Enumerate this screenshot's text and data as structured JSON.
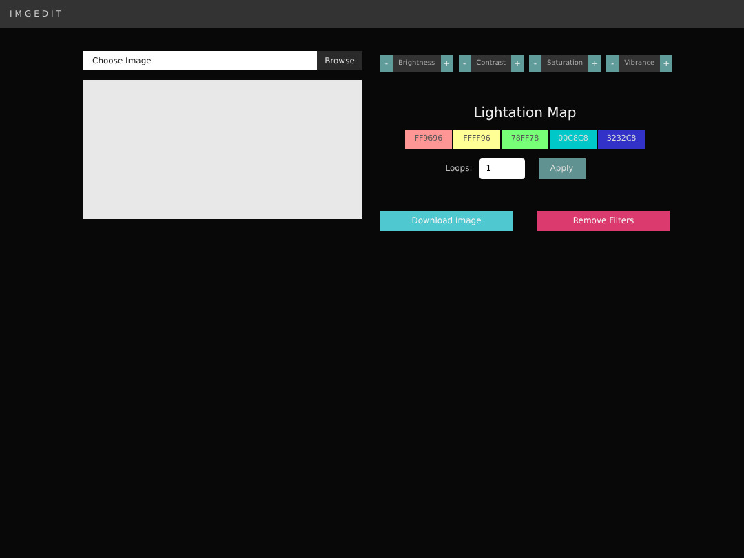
{
  "header": {
    "title": "IMGEDIT"
  },
  "file_picker": {
    "placeholder": "Choose Image",
    "button": "Browse"
  },
  "image_preview": {
    "kind": "empty"
  },
  "adjusters": [
    {
      "minus": "-",
      "label": "Brightness",
      "plus": "+"
    },
    {
      "minus": "-",
      "label": "Contrast",
      "plus": "+"
    },
    {
      "minus": "-",
      "label": "Saturation",
      "plus": "+"
    },
    {
      "minus": "-",
      "label": "Vibrance",
      "plus": "+"
    }
  ],
  "lightation_map": {
    "title": "Lightation Map",
    "swatches": [
      {
        "label": "FF9696",
        "color": "#ff9696"
      },
      {
        "label": "FFFF96",
        "color": "#ffff96"
      },
      {
        "label": "78FF78",
        "color": "#78ff78"
      },
      {
        "label": "00C8C8",
        "color": "#00c8c8"
      },
      {
        "label": "3232C8",
        "color": "#3232c8"
      }
    ],
    "loops_label": "Loops:",
    "loops_value": "1",
    "apply": "Apply"
  },
  "actions": {
    "download": "Download Image",
    "remove": "Remove Filters"
  }
}
